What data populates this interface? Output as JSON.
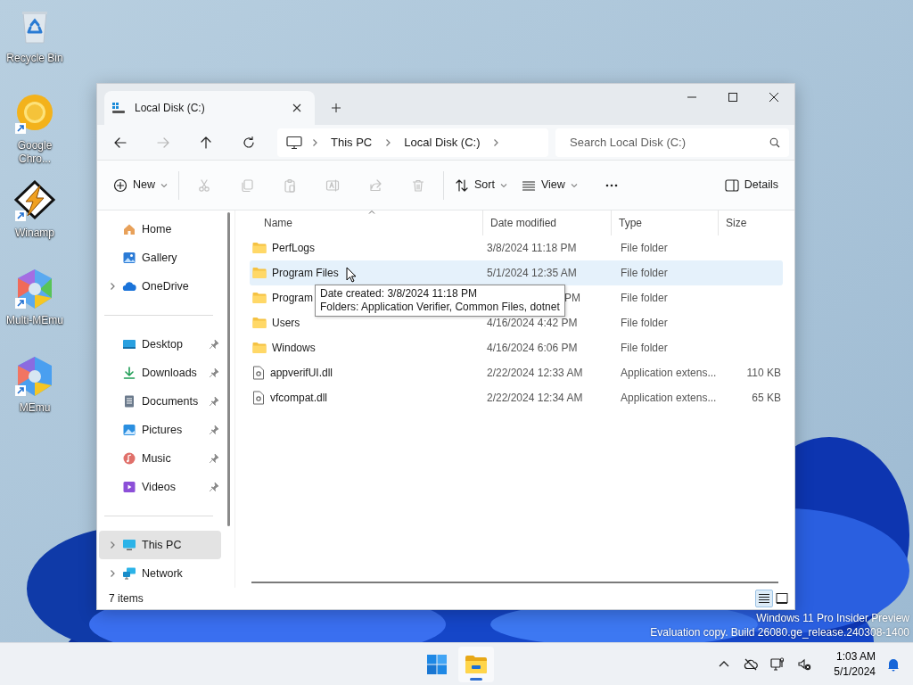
{
  "desktop_icons": [
    {
      "label": "Recycle Bin",
      "kind": "recycle",
      "shortcut": false
    },
    {
      "label": "Google Chro...",
      "kind": "ring",
      "shortcut": true
    },
    {
      "label": "Winamp",
      "kind": "bolt",
      "shortcut": true
    },
    {
      "label": "Multi-MEmu",
      "kind": "multi_hexagon",
      "shortcut": true
    },
    {
      "label": "MEmu",
      "kind": "hexagon",
      "shortcut": true
    }
  ],
  "window": {
    "tab": {
      "title": "Local Disk (C:)"
    },
    "nav_buttons": [
      {
        "kind": "back",
        "disabled": false
      },
      {
        "kind": "forward",
        "disabled": true
      },
      {
        "kind": "up",
        "disabled": false
      },
      {
        "kind": "refresh",
        "disabled": false
      }
    ],
    "breadcrumb": [
      "This PC",
      "Local Disk (C:)"
    ],
    "search": {
      "placeholder": "Search Local Disk (C:)"
    },
    "toolbar": [
      {
        "kind": "new",
        "label": "New",
        "disabled": false,
        "dropdown": true
      },
      {
        "kind": "cut",
        "disabled": true,
        "dropdown": false
      },
      {
        "kind": "copy",
        "disabled": true,
        "dropdown": false
      },
      {
        "kind": "paste",
        "disabled": true,
        "dropdown": false
      },
      {
        "kind": "rename",
        "disabled": true,
        "dropdown": false
      },
      {
        "kind": "share",
        "disabled": true,
        "dropdown": false
      },
      {
        "kind": "delete",
        "disabled": true,
        "dropdown": false
      },
      {
        "kind": "sort",
        "label": "Sort",
        "disabled": false,
        "dropdown": true
      },
      {
        "kind": "view",
        "label": "View",
        "disabled": false,
        "dropdown": true
      },
      {
        "kind": "more",
        "disabled": false,
        "dropdown": false
      }
    ],
    "details_button": {
      "label": "Details"
    },
    "sidebar": {
      "groups": [
        {
          "items": [
            {
              "label": "Home",
              "kind": "home",
              "expandable": false,
              "pinned": false,
              "selected": false
            },
            {
              "label": "Gallery",
              "kind": "gallery",
              "expandable": false,
              "pinned": false,
              "selected": false
            },
            {
              "label": "OneDrive",
              "kind": "cloud",
              "expandable": true,
              "pinned": false,
              "selected": false
            }
          ]
        },
        {
          "items": [
            {
              "label": "Desktop",
              "kind": "desktop",
              "expandable": false,
              "pinned": true,
              "selected": false
            },
            {
              "label": "Downloads",
              "kind": "downloads",
              "expandable": false,
              "pinned": true,
              "selected": false
            },
            {
              "label": "Documents",
              "kind": "documents",
              "expandable": false,
              "pinned": true,
              "selected": false
            },
            {
              "label": "Pictures",
              "kind": "pictures",
              "expandable": false,
              "pinned": true,
              "selected": false
            },
            {
              "label": "Music",
              "kind": "music",
              "expandable": false,
              "pinned": true,
              "selected": false
            },
            {
              "label": "Videos",
              "kind": "videos",
              "expandable": false,
              "pinned": true,
              "selected": false
            }
          ]
        },
        {
          "items": [
            {
              "label": "This PC",
              "kind": "pc",
              "expandable": true,
              "pinned": false,
              "selected": true
            },
            {
              "label": "Network",
              "kind": "network",
              "expandable": true,
              "pinned": false,
              "selected": false
            }
          ]
        }
      ]
    },
    "table": {
      "columns": [
        "Name",
        "Date modified",
        "Type",
        "Size"
      ],
      "rows": [
        {
          "kind": "folder",
          "name": "PerfLogs",
          "date_modified": "3/8/2024 11:18 PM",
          "type": "File folder",
          "selected": false,
          "covered": false
        },
        {
          "kind": "folder",
          "name": "Program Files",
          "date_modified": "5/1/2024 12:35 AM",
          "type": "File folder",
          "selected": true,
          "covered": false
        },
        {
          "kind": "folder",
          "name": "Program",
          "date_modified": "PM",
          "type": "File folder",
          "selected": false,
          "covered": true
        },
        {
          "kind": "folder",
          "name": "Users",
          "date_modified": "4/16/2024 4:42 PM",
          "type": "File folder",
          "selected": false,
          "covered": false
        },
        {
          "kind": "folder",
          "name": "Windows",
          "date_modified": "4/16/2024 6:06 PM",
          "type": "File folder",
          "selected": false,
          "covered": false
        },
        {
          "kind": "dll",
          "name": "appverifUI.dll",
          "date_modified": "2/22/2024 12:33 AM",
          "type": "Application extens...",
          "size": "110 KB",
          "selected": false,
          "covered": false
        },
        {
          "kind": "dll",
          "name": "vfcompat.dll",
          "date_modified": "2/22/2024 12:34 AM",
          "type": "Application extens...",
          "size": "65 KB",
          "selected": false,
          "covered": false
        }
      ]
    },
    "tooltip": [
      "Date created: 3/8/2024 11:18 PM",
      "Folders: Application Verifier, Common Files, dotnet"
    ],
    "status_bar": {
      "item_count": "7 items",
      "view_modes": [
        {
          "kind": "details",
          "selected": true
        },
        {
          "kind": "tiles",
          "selected": false
        }
      ]
    }
  },
  "watermark": [
    "Windows 11 Pro Insider Preview",
    "Evaluation copy. Build 26080.ge_release.240308-1400"
  ],
  "taskbar": {
    "apps": [
      {
        "kind": "start",
        "running": false
      },
      {
        "kind": "explorer",
        "running": true
      }
    ],
    "tray": [
      {
        "kind": "chevron"
      },
      {
        "kind": "cloud_off"
      },
      {
        "kind": "network"
      },
      {
        "kind": "volume_mute"
      }
    ],
    "clock": {
      "time": "1:03 AM",
      "date": "5/1/2024"
    }
  }
}
